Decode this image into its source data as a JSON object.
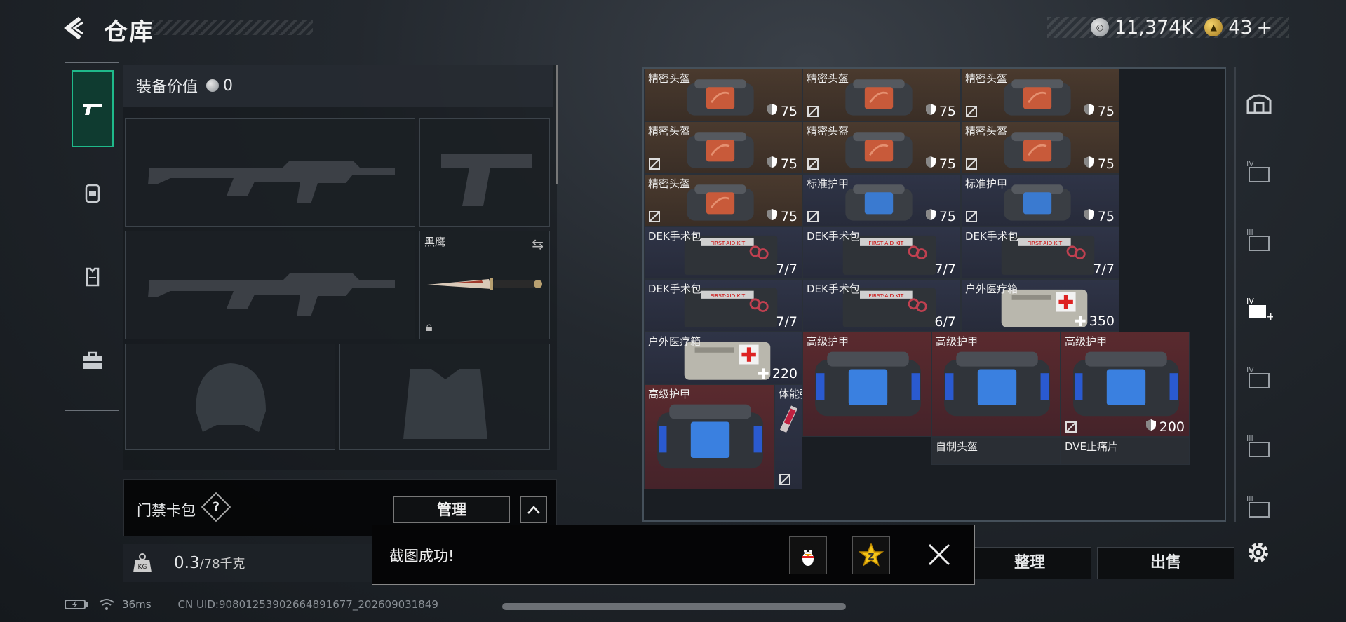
{
  "header": {
    "title": "仓库"
  },
  "currency": {
    "coins": "11,374K",
    "tickets": "43",
    "plus": "+"
  },
  "equip": {
    "value_label": "装备价值",
    "value": "0",
    "melee_label": "黑鹰",
    "card_label": "门禁卡包",
    "help_label": "?",
    "manage_label": "管理",
    "weight_value": "0.3",
    "weight_max": "/78千克"
  },
  "grid": [
    {
      "name": "精密头盔",
      "val": "75",
      "bg": "brown",
      "kind": "helmet",
      "noinsure": false
    },
    {
      "name": "精密头盔",
      "val": "75",
      "bg": "brown",
      "kind": "helmet",
      "noinsure": true
    },
    {
      "name": "精密头盔",
      "val": "75",
      "bg": "brown",
      "kind": "helmet",
      "noinsure": true
    },
    {
      "name": "精密头盔",
      "val": "75",
      "bg": "brown",
      "kind": "helmet",
      "noinsure": true
    },
    {
      "name": "精密头盔",
      "val": "75",
      "bg": "brown",
      "kind": "helmet",
      "noinsure": true
    },
    {
      "name": "精密头盔",
      "val": "75",
      "bg": "brown",
      "kind": "helmet",
      "noinsure": true
    },
    {
      "name": "精密头盔",
      "val": "75",
      "bg": "brown",
      "kind": "helmet",
      "noinsure": true
    },
    {
      "name": "标准护甲",
      "val": "75",
      "bg": "blue",
      "kind": "armor",
      "noinsure": true
    },
    {
      "name": "标准护甲",
      "val": "75",
      "bg": "blue",
      "kind": "armor",
      "noinsure": true
    },
    {
      "name": "DEK手术包",
      "val": "7/7",
      "bg": "blue",
      "kind": "kit",
      "noinsure": false
    },
    {
      "name": "DEK手术包",
      "val": "7/7",
      "bg": "blue",
      "kind": "kit",
      "noinsure": false
    },
    {
      "name": "DEK手术包",
      "val": "7/7",
      "bg": "blue",
      "kind": "kit",
      "noinsure": false
    },
    {
      "name": "DEK手术包",
      "val": "7/7",
      "bg": "blue",
      "kind": "kit",
      "noinsure": false
    },
    {
      "name": "DEK手术包",
      "val": "6/7",
      "bg": "blue",
      "kind": "kit",
      "noinsure": false
    },
    {
      "name": "户外医疗箱",
      "val": "350",
      "bg": "blue",
      "kind": "medbox",
      "noinsure": false
    },
    {
      "name": "户外医疗箱",
      "val": "220",
      "bg": "blue",
      "kind": "medbox",
      "noinsure": false
    },
    {
      "name": "高级护甲",
      "val": "",
      "bg": "red",
      "kind": "heavy",
      "noinsure": false
    },
    {
      "name": "高级护甲",
      "val": "",
      "bg": "red",
      "kind": "heavy",
      "noinsure": false
    },
    {
      "name": "高级护甲",
      "val": "200",
      "bg": "red",
      "kind": "heavy",
      "noinsure": true
    },
    {
      "name": "高级护甲",
      "val": "",
      "bg": "red",
      "kind": "heavy",
      "noinsure": false
    },
    {
      "name": "体能强化剂",
      "val": "",
      "bg": "blue",
      "kind": "syringe",
      "noinsure": true
    },
    {
      "name": "自制头盔",
      "val": "",
      "bg": "dark",
      "kind": "none",
      "noinsure": false
    },
    {
      "name": "DVE止痛片",
      "val": "",
      "bg": "dark",
      "kind": "none",
      "noinsure": false
    }
  ],
  "buttons": {
    "tidy": "整理",
    "sell": "出售"
  },
  "toast": {
    "text": "截图成功!"
  },
  "status": {
    "ping": "36ms",
    "uid": "CN UID:9080125390266489167​7_202609031849"
  }
}
